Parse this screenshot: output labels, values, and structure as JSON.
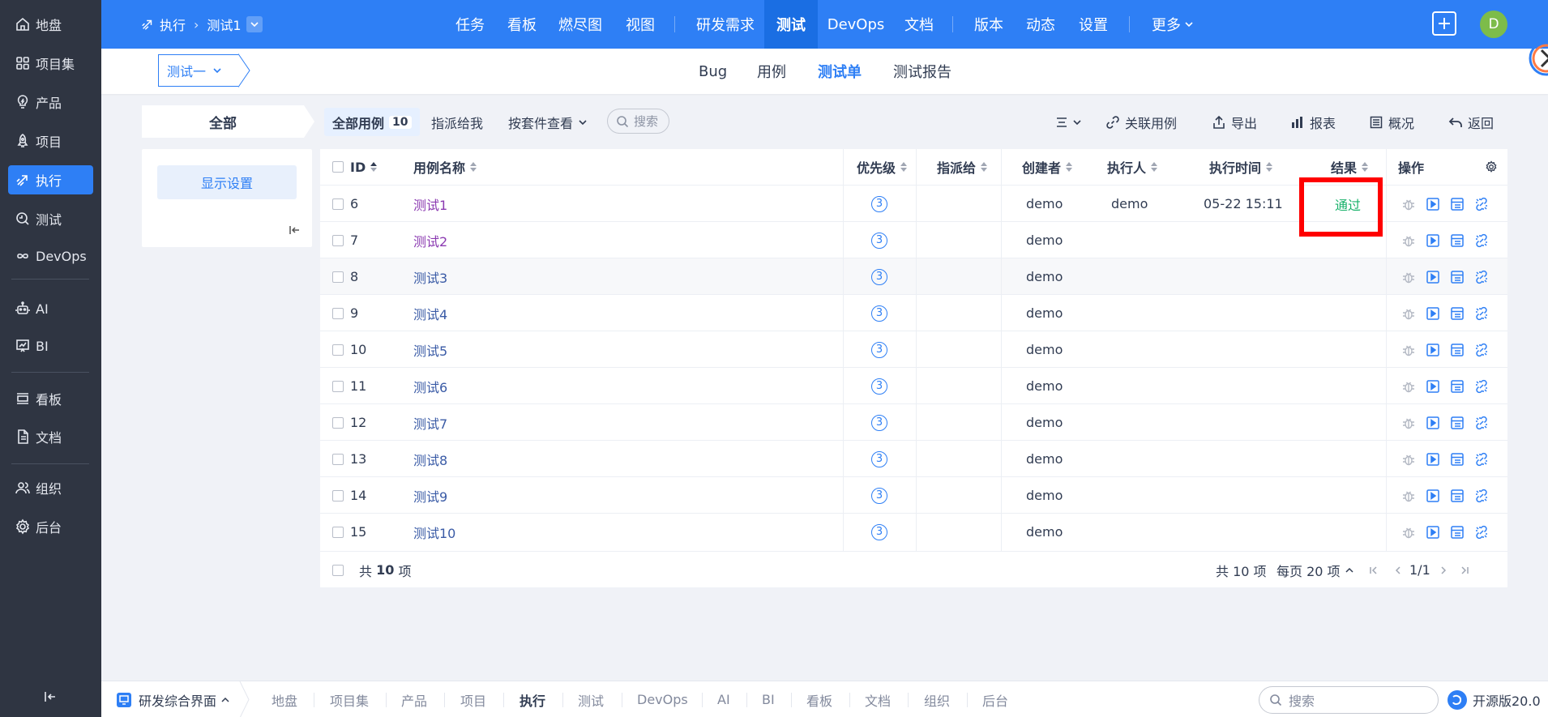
{
  "sidebar": {
    "items": [
      {
        "label": "地盘",
        "icon": "home-icon"
      },
      {
        "label": "项目集",
        "icon": "grid-icon"
      },
      {
        "label": "产品",
        "icon": "bulb-icon"
      },
      {
        "label": "项目",
        "icon": "rocket-icon"
      },
      {
        "label": "执行",
        "icon": "run-icon",
        "active": true
      },
      {
        "label": "测试",
        "icon": "test-icon"
      },
      {
        "label": "DevOps",
        "icon": "infinity-icon"
      },
      {
        "label": "AI",
        "icon": "robot-icon"
      },
      {
        "label": "BI",
        "icon": "chart-icon"
      },
      {
        "label": "看板",
        "icon": "kanban-icon"
      },
      {
        "label": "文档",
        "icon": "doc-icon"
      },
      {
        "label": "组织",
        "icon": "users-icon"
      },
      {
        "label": "后台",
        "icon": "gear-icon"
      }
    ]
  },
  "topbar": {
    "crumb_root": "执行",
    "crumb_current": "测试1",
    "nav": [
      "任务",
      "看板",
      "燃尽图",
      "视图",
      "研发需求",
      "测试",
      "DevOps",
      "文档",
      "版本",
      "动态",
      "设置",
      "更多"
    ],
    "active_nav": "测试",
    "avatar_letter": "D"
  },
  "subbar": {
    "selector": "测试一",
    "tabs": [
      "Bug",
      "用例",
      "测试单",
      "测试报告"
    ],
    "active_tab": "测试单"
  },
  "toolbar": {
    "all_label": "全部",
    "all_cases_label": "全部用例",
    "all_cases_count": "10",
    "assigned_label": "指派给我",
    "suite_view_label": "按套件查看",
    "search_label": "搜索",
    "link_case": "关联用例",
    "export": "导出",
    "report": "报表",
    "overview": "概况",
    "back": "返回"
  },
  "leftpanel": {
    "display_settings": "显示设置"
  },
  "table": {
    "headers": {
      "id": "ID",
      "name": "用例名称",
      "priority": "优先级",
      "assigned": "指派给",
      "creator": "创建者",
      "executor": "执行人",
      "exec_time": "执行时间",
      "result": "结果",
      "actions": "操作"
    },
    "rows": [
      {
        "id": "6",
        "name": "测试1",
        "priority": "3",
        "assigned": "",
        "creator": "demo",
        "executor": "demo",
        "exec_time": "05-22 15:11",
        "result": "通过"
      },
      {
        "id": "7",
        "name": "测试2",
        "priority": "3",
        "assigned": "",
        "creator": "demo",
        "executor": "",
        "exec_time": "",
        "result": ""
      },
      {
        "id": "8",
        "name": "测试3",
        "priority": "3",
        "assigned": "",
        "creator": "demo",
        "executor": "",
        "exec_time": "",
        "result": ""
      },
      {
        "id": "9",
        "name": "测试4",
        "priority": "3",
        "assigned": "",
        "creator": "demo",
        "executor": "",
        "exec_time": "",
        "result": ""
      },
      {
        "id": "10",
        "name": "测试5",
        "priority": "3",
        "assigned": "",
        "creator": "demo",
        "executor": "",
        "exec_time": "",
        "result": ""
      },
      {
        "id": "11",
        "name": "测试6",
        "priority": "3",
        "assigned": "",
        "creator": "demo",
        "executor": "",
        "exec_time": "",
        "result": ""
      },
      {
        "id": "12",
        "name": "测试7",
        "priority": "3",
        "assigned": "",
        "creator": "demo",
        "executor": "",
        "exec_time": "",
        "result": ""
      },
      {
        "id": "13",
        "name": "测试8",
        "priority": "3",
        "assigned": "",
        "creator": "demo",
        "executor": "",
        "exec_time": "",
        "result": ""
      },
      {
        "id": "14",
        "name": "测试9",
        "priority": "3",
        "assigned": "",
        "creator": "demo",
        "executor": "",
        "exec_time": "",
        "result": ""
      },
      {
        "id": "15",
        "name": "测试10",
        "priority": "3",
        "assigned": "",
        "creator": "demo",
        "executor": "",
        "exec_time": "",
        "result": ""
      }
    ],
    "footer": {
      "total_prefix": "共",
      "total_count": "10",
      "total_suffix": "项",
      "pager_total": "共 10 项",
      "per_page": "每页 20 项",
      "page": "1/1"
    }
  },
  "bottombar": {
    "workspace": "研发综合界面",
    "items": [
      "地盘",
      "项目集",
      "产品",
      "项目",
      "执行",
      "测试",
      "DevOps",
      "AI",
      "BI",
      "看板",
      "文档",
      "组织",
      "后台"
    ],
    "active": "执行",
    "search_placeholder": "搜索",
    "version": "开源版20.0"
  },
  "colors": {
    "primary": "#2e7ff5",
    "sidebar_bg": "#2f3542",
    "pass": "#1ab26b",
    "highlight_box": "#ff0000"
  }
}
